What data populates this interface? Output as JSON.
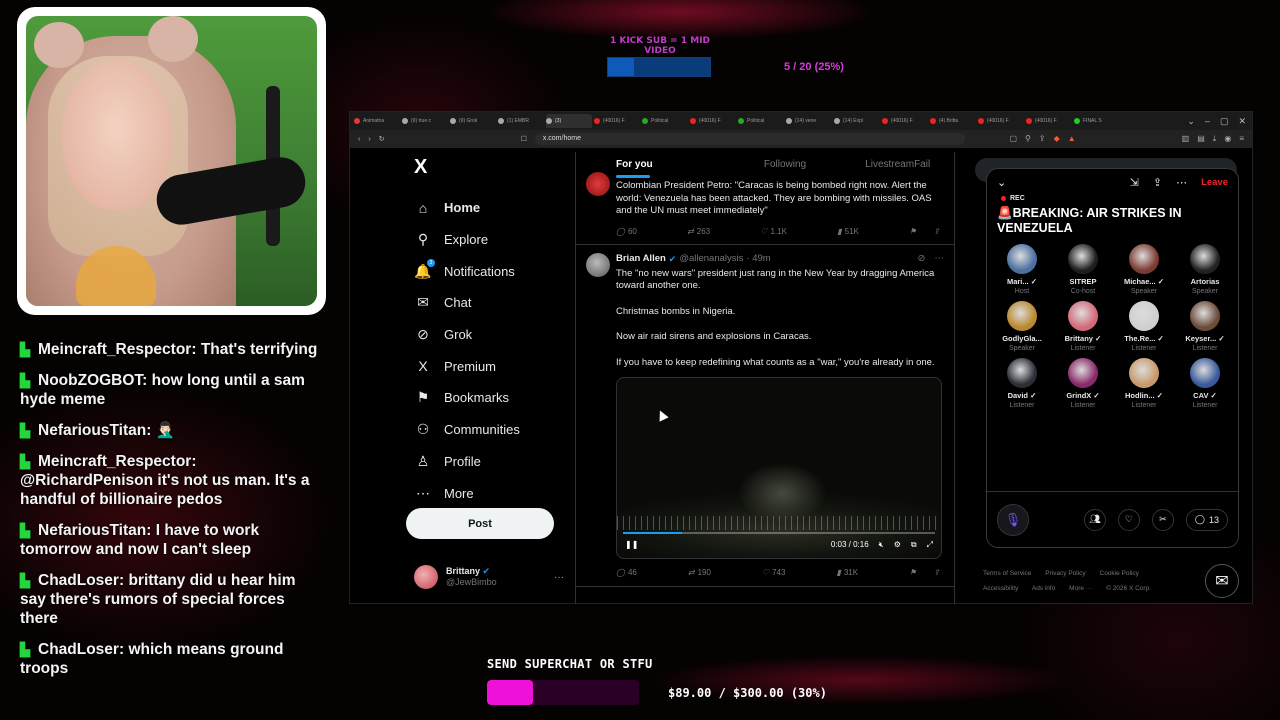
{
  "top_goal": {
    "label": "1 KICK SUB = 1 MID VIDEO",
    "progress_text": "5 / 20 (25%)",
    "fraction": 0.25
  },
  "chat": [
    {
      "user": "Meincraft_Respector:",
      "text": "That's terrifying"
    },
    {
      "user": "NoobZOGBOT:",
      "text": "how long until a sam hyde meme"
    },
    {
      "user": "NefariousTitan:",
      "text": "🤦🏻‍♂️"
    },
    {
      "user": "Meincraft_Respector:",
      "text": "@RichardPenison it's not us man. It's a handful of billionaire pedos"
    },
    {
      "user": "NefariousTitan:",
      "text": "I have to work tomorrow and now I can't sleep"
    },
    {
      "user": "ChadLoser:",
      "text": "brittany did u hear him say there's rumors of special forces there"
    },
    {
      "user": "ChadLoser:",
      "text": "which means ground troops"
    }
  ],
  "browser": {
    "tabs": [
      "Animatria",
      "(9) true c",
      "(9) Grok",
      "(1) EMBR",
      "(3)",
      "(40016) F",
      "Political",
      "(40016) F",
      "Political",
      "(14) vene",
      "(14) Expl",
      "(40016) F",
      "(4) Britta",
      "(40016) F",
      "(40016) F",
      "FINAL S"
    ],
    "url": "x.com/home"
  },
  "nav": {
    "logo": "X",
    "items": [
      {
        "label": "Home",
        "icon": "⌂",
        "icon_name": "home-icon"
      },
      {
        "label": "Explore",
        "icon": "⚲",
        "icon_name": "search-icon"
      },
      {
        "label": "Notifications",
        "icon": "🔔",
        "icon_name": "bell-icon",
        "badge": "3"
      },
      {
        "label": "Chat",
        "icon": "✉",
        "icon_name": "chat-icon"
      },
      {
        "label": "Grok",
        "icon": "⊘",
        "icon_name": "grok-icon"
      },
      {
        "label": "Premium",
        "icon": "X",
        "icon_name": "premium-icon"
      },
      {
        "label": "Bookmarks",
        "icon": "⚑",
        "icon_name": "bookmark-icon"
      },
      {
        "label": "Communities",
        "icon": "⚇",
        "icon_name": "communities-icon"
      },
      {
        "label": "Profile",
        "icon": "♙",
        "icon_name": "profile-icon"
      },
      {
        "label": "More",
        "icon": "⋯",
        "icon_name": "more-icon"
      }
    ],
    "post_label": "Post",
    "profile": {
      "name": "Brittany",
      "handle": "@JewBimbo",
      "more": "···"
    }
  },
  "feed": {
    "tabs": [
      "For you",
      "Following",
      "LivestreamFail"
    ],
    "tweet1": {
      "text": "Colombian President Petro: \"Caracas is being bombed right now. Alert the world: Venezuela has been attacked. They are bombing with missiles. OAS and the UN must meet immediately\"",
      "replies": "60",
      "reposts": "263",
      "likes": "1.1K",
      "views": "51K"
    },
    "tweet2": {
      "name": "Brian Allen",
      "handle": "@allenanalysis",
      "time": "· 49m",
      "paragraphs": [
        "The \"no new wars\" president just rang in the New Year by dragging America toward another one.",
        "Christmas bombs in Nigeria.",
        "Now air raid sirens and explosions in Caracas.",
        "If you have to keep redefining what counts as a \"war,\" you're already in one."
      ],
      "video_time": "0:03 / 0:16",
      "video_progress": 0.19,
      "replies": "46",
      "reposts": "190",
      "likes": "743",
      "views": "31K"
    }
  },
  "right_footer": {
    "links": [
      "Terms of Service",
      "Privacy Policy",
      "Cookie Policy",
      "Accessibility",
      "Ads info",
      "More ···",
      "© 2026 X Corp."
    ]
  },
  "spaces": {
    "rec": "REC",
    "leave": "Leave",
    "title": "🚨BREAKING: AIR STRIKES IN VENEZUELA",
    "participants": [
      {
        "name": "Mari... ✓",
        "role": "Host",
        "color": "#4a6fa0"
      },
      {
        "name": "SITREP",
        "role": "Co-host",
        "color": "#1d1f1d"
      },
      {
        "name": "Michae... ✓",
        "role": "Speaker",
        "color": "#7b3b32"
      },
      {
        "name": "Artorias",
        "role": "Speaker",
        "color": "#222222"
      },
      {
        "name": "GodlyGla...",
        "role": "Speaker",
        "color": "#b8892e"
      },
      {
        "name": "Brittany ✓",
        "role": "Listener",
        "color": "#d46a7a"
      },
      {
        "name": "The.Re... ✓",
        "role": "Listener",
        "color": "#cfcfcf"
      },
      {
        "name": "Keyser... ✓",
        "role": "Listener",
        "color": "#6b4b3a"
      },
      {
        "name": "David ✓",
        "role": "Listener",
        "color": "#2a2f36"
      },
      {
        "name": "GrindX ✓",
        "role": "Listener",
        "color": "#8a2a6a"
      },
      {
        "name": "Hodlin... ✓",
        "role": "Listener",
        "color": "#c89a6a"
      },
      {
        "name": "CAV ✓",
        "role": "Listener",
        "color": "#3a5a9a"
      }
    ],
    "count": "13"
  },
  "bottom_goal": {
    "label": "SEND SUPERCHAT OR STFU",
    "amount": "$89.00 / $300.00 (30%)",
    "fraction": 0.3
  }
}
